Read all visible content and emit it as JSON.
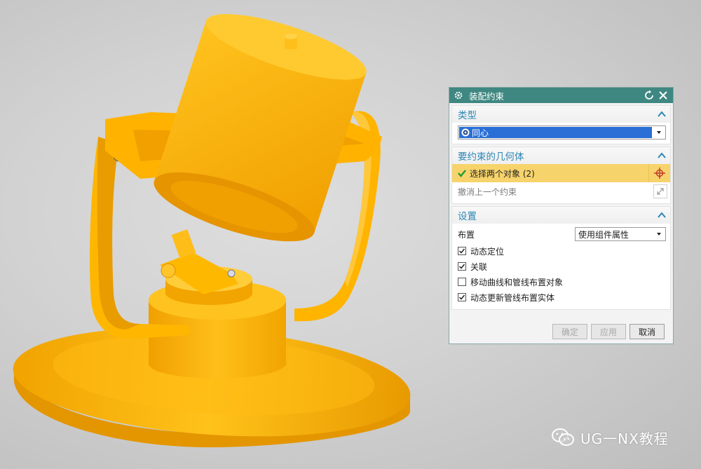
{
  "dialog": {
    "title": "装配约束",
    "sections": {
      "type": {
        "header": "类型",
        "selected": "同心"
      },
      "geometry": {
        "header": "要约束的几何体",
        "select_label": "选择两个对象 (2)",
        "undo_label": "撤消上一个约束"
      },
      "settings": {
        "header": "设置",
        "layout_label": "布置",
        "layout_value": "使用组件属性",
        "checkboxes": [
          {
            "label": "动态定位",
            "checked": true
          },
          {
            "label": "关联",
            "checked": true
          },
          {
            "label": "移动曲线和管线布置对象",
            "checked": false
          },
          {
            "label": "动态更新管线布置实体",
            "checked": true
          }
        ]
      }
    },
    "buttons": {
      "ok": "确定",
      "apply": "应用",
      "cancel": "取消"
    }
  },
  "watermark": "UG一NX教程",
  "colors": {
    "title_bar": "#3f8781",
    "section_header": "#2c86b3",
    "selection_highlight": "#f7d36b",
    "model_orange": "#ffb000"
  }
}
